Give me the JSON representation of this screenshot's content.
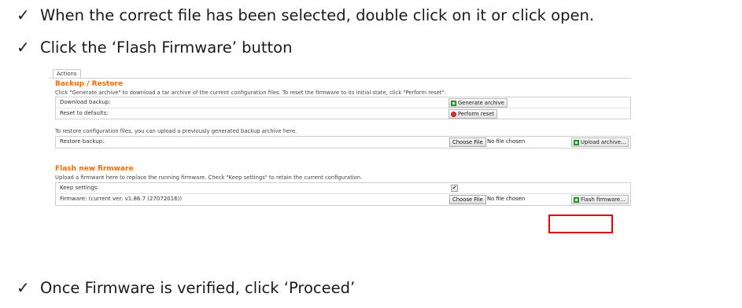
{
  "steps": [
    {
      "check": "✓",
      "text": "When the correct file has been selected, double click on it or click open."
    },
    {
      "check": "✓",
      "text": "Click the ‘Flash Firmware’ button"
    },
    {
      "check": "✓",
      "text": "Once Firmware is verified, click ‘Proceed’"
    }
  ],
  "screenshot": {
    "tab_label": "Actions",
    "backup": {
      "title": "Backup / Restore",
      "description": "Click \"Generate archive\" to download a tar archive of the current configuration files. To reset the firmware to its initial state, click \"Perform reset\".",
      "rows": [
        {
          "label": "Download backup:",
          "button": "Generate archive",
          "icon": "green-square-icon"
        },
        {
          "label": "Reset to defaults:",
          "button": "Perform reset",
          "icon": "red-circle-icon"
        }
      ]
    },
    "restore": {
      "description": "To restore configuration files, you can upload a previously generated backup archive here.",
      "row": {
        "label": "Restore backup:",
        "file_button": "Choose File",
        "file_status": "No file chosen",
        "button": "Upload archive..."
      }
    },
    "flash": {
      "title": "Flash new firmware",
      "description": "Upload a firmware here to replace the running firmware. Check \"Keep settings\" to retain the current configuration.",
      "keep_label": "Keep settings:",
      "keep_checked": "✔",
      "firmware_label": "Firmware: (current ver: v1.86.7 (27072016))",
      "file_button": "Choose File",
      "file_status": "No file chosen",
      "button": "Flash firmware..."
    },
    "highlight_color": "#e00000",
    "accent_color": "#ff6a00"
  }
}
